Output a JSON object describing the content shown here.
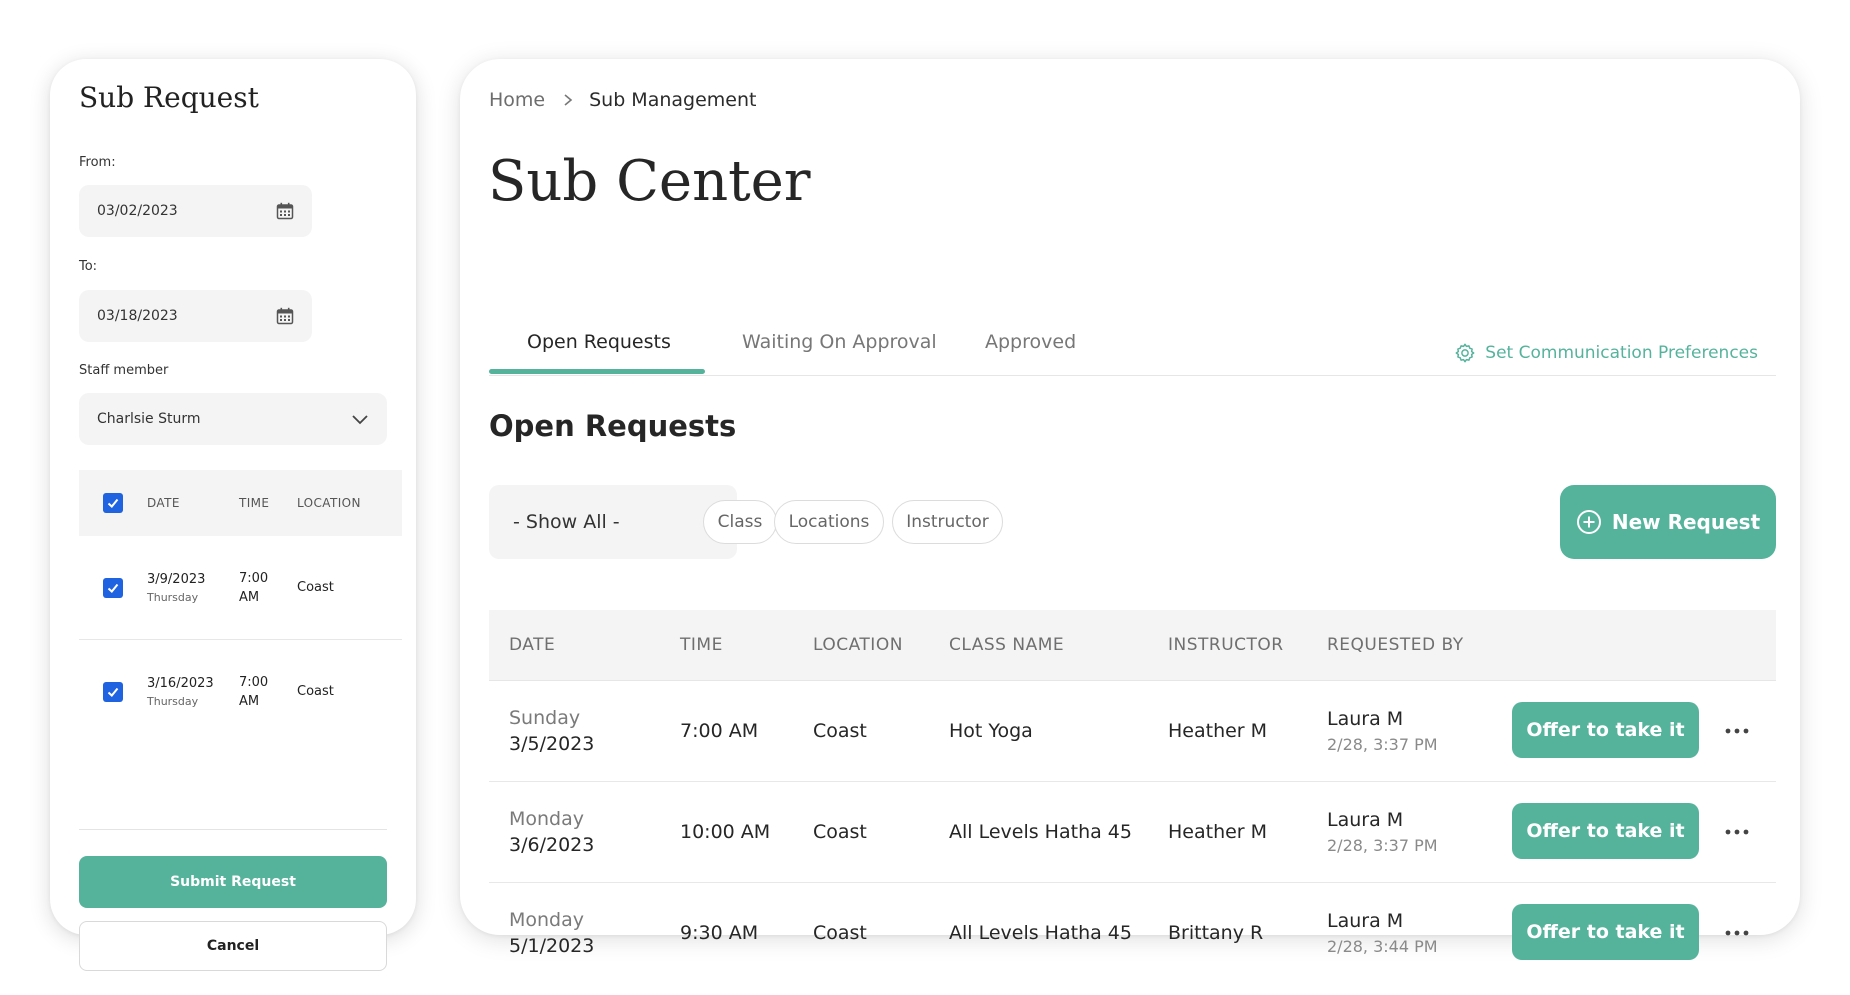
{
  "sub_request": {
    "title": "Sub Request",
    "from_label": "From:",
    "from_value": "03/02/2023",
    "to_label": "To:",
    "to_value": "03/18/2023",
    "staff_label": "Staff member",
    "staff_value": "Charlsie Sturm",
    "table": {
      "headers": [
        "DATE",
        "TIME",
        "LOCATION"
      ],
      "rows": [
        {
          "date": "3/9/2023",
          "day": "Thursday",
          "time_1": "7:00",
          "time_2": "AM",
          "location": "Coast"
        },
        {
          "date": "3/16/2023",
          "day": "Thursday",
          "time_1": "7:00",
          "time_2": "AM",
          "location": "Coast"
        }
      ]
    },
    "submit_label": "Submit Request",
    "cancel_label": "Cancel"
  },
  "sub_center": {
    "breadcrumb": {
      "home": "Home",
      "current": "Sub Management"
    },
    "title": "Sub Center",
    "tabs": [
      {
        "label": "Open Requests",
        "active": true
      },
      {
        "label": "Waiting On Approval",
        "active": false
      },
      {
        "label": "Approved",
        "active": false
      }
    ],
    "comm_pref_label": "Set Communication Preferences",
    "section_title": "Open Requests",
    "filter": {
      "show_all": "- Show All -",
      "pills": [
        "Class",
        "Locations",
        "Instructor"
      ]
    },
    "new_request_label": "New Request",
    "table": {
      "headers": [
        "DATE",
        "TIME",
        "LOCATION",
        "CLASS NAME",
        "INSTRUCTOR",
        "REQUESTED BY"
      ],
      "rows": [
        {
          "day": "Sunday",
          "date": "3/5/2023",
          "time": "7:00 AM",
          "location": "Coast",
          "class_name": "Hot Yoga",
          "instructor": "Heather M",
          "requested_by": "Laura M",
          "requested_at": "2/28, 3:37 PM",
          "action": "Offer to take it"
        },
        {
          "day": "Monday",
          "date": "3/6/2023",
          "time": "10:00 AM",
          "location": "Coast",
          "class_name": "All Levels Hatha 45",
          "instructor": "Heather M",
          "requested_by": "Laura M",
          "requested_at": "2/28, 3:37 PM",
          "action": "Offer to take it"
        },
        {
          "day": "Monday",
          "date": "5/1/2023",
          "time": "9:30 AM",
          "location": "Coast",
          "class_name": "All Levels Hatha 45",
          "instructor": "Brittany R",
          "requested_by": "Laura M",
          "requested_at": "2/28, 3:44 PM",
          "action": "Offer to take it"
        }
      ]
    }
  },
  "colors": {
    "accent": "#55b39c",
    "checkbox": "#1f63e0",
    "field_bg": "#f4f4f5"
  }
}
